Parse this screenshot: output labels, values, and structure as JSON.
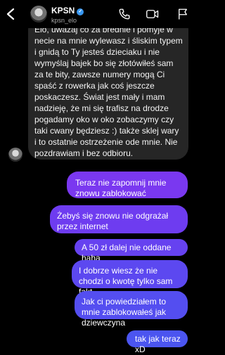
{
  "header": {
    "name": "KPSN",
    "handle": "kpsn_elo"
  },
  "received": {
    "text": "Elo, uważaj co za brednie i pomyje w necie na mnie wylewasz i śliskim typem i gnidą to Ty jesteś dzieciaku i nie wymyślaj bajek bo się złotówiłeś sam za te bity, zawsze numery mogą Ci spaść z rowerka jak coś jeszcze poskaczesz. Świat jest mały i mam nadzieję, że mi się trafisz na drodze pogadamy oko w oko zobaczymy czy taki cwany będziesz :) także sklej wary i to ostatnie ostrzeżenie ode mnie. Nie pozdrawiam i bez odbioru."
  },
  "sent_messages": [
    "Teraz nie zapomnij mnie znowu zablokować",
    "Żebyś się znowu nie odgrażał przez internet",
    "A 50 zł dalej nie oddane haha",
    "I dobrze wiesz że nie chodzi o kwotę tylko sam fakt",
    "Jak ci powiedziałem to mnie zablokowałeś jak dziewczyna",
    "tak jak teraz xD"
  ],
  "colors": {
    "background": "#000000",
    "received_bubble": "#262626",
    "sent_bubble_top": "#7a38f0",
    "sent_bubble_bottom": "#4a55f0",
    "verified": "#3897f0"
  }
}
